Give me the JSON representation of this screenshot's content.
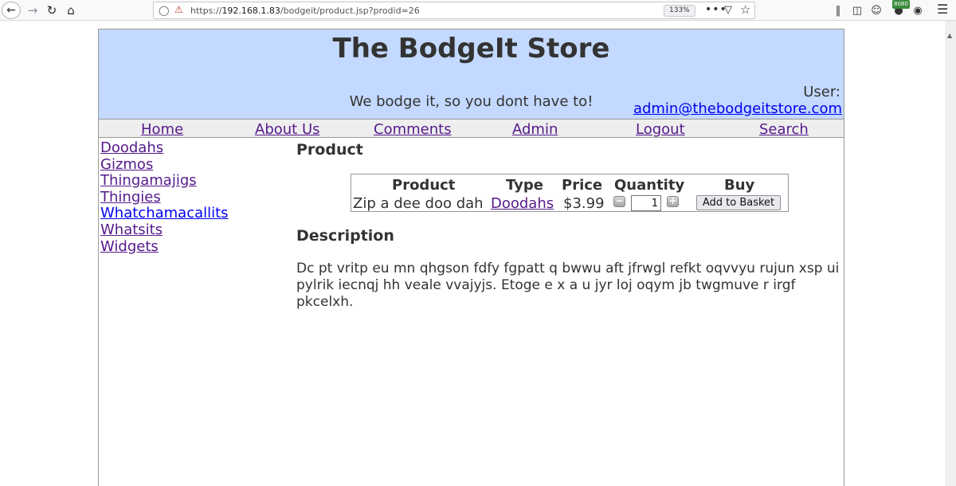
{
  "browser": {
    "url_prefix": "https://",
    "url_host": "192.168.1.83",
    "url_path": "/bodgeit/product.jsp?prodid=26",
    "zoom": "133%",
    "badge": "8080"
  },
  "header": {
    "title": "The BodgeIt Store",
    "tagline": "We bodge it, so you dont have to!",
    "user_label": "User:",
    "user_email": "admin@thebodgeitstore.com"
  },
  "nav": [
    "Home",
    "About Us",
    "Comments",
    "Admin",
    "Logout",
    "Search"
  ],
  "sidebar": [
    "Doodahs",
    "Gizmos",
    "Thingamajigs",
    "Thingies",
    "Whatchamacallits",
    "Whatsits",
    "Widgets"
  ],
  "product": {
    "heading": "Product",
    "columns": [
      "Product",
      "Type",
      "Price",
      "Quantity",
      "Buy"
    ],
    "name": "Zip a dee doo dah",
    "type": "Doodahs",
    "price": "$3.99",
    "quantity": "1",
    "buy_label": "Add to Basket"
  },
  "description": {
    "heading": "Description",
    "text": "Dc pt vritp eu mn qhgson fdfy fgpatt q bwwu aft jfrwgl refkt oqvvyu rujun xsp ui pylrik iecnqj hh veale vvajyjs. Etoge e x a u jyr loj oqym jb twgmuve r irgf pkcelxh."
  }
}
